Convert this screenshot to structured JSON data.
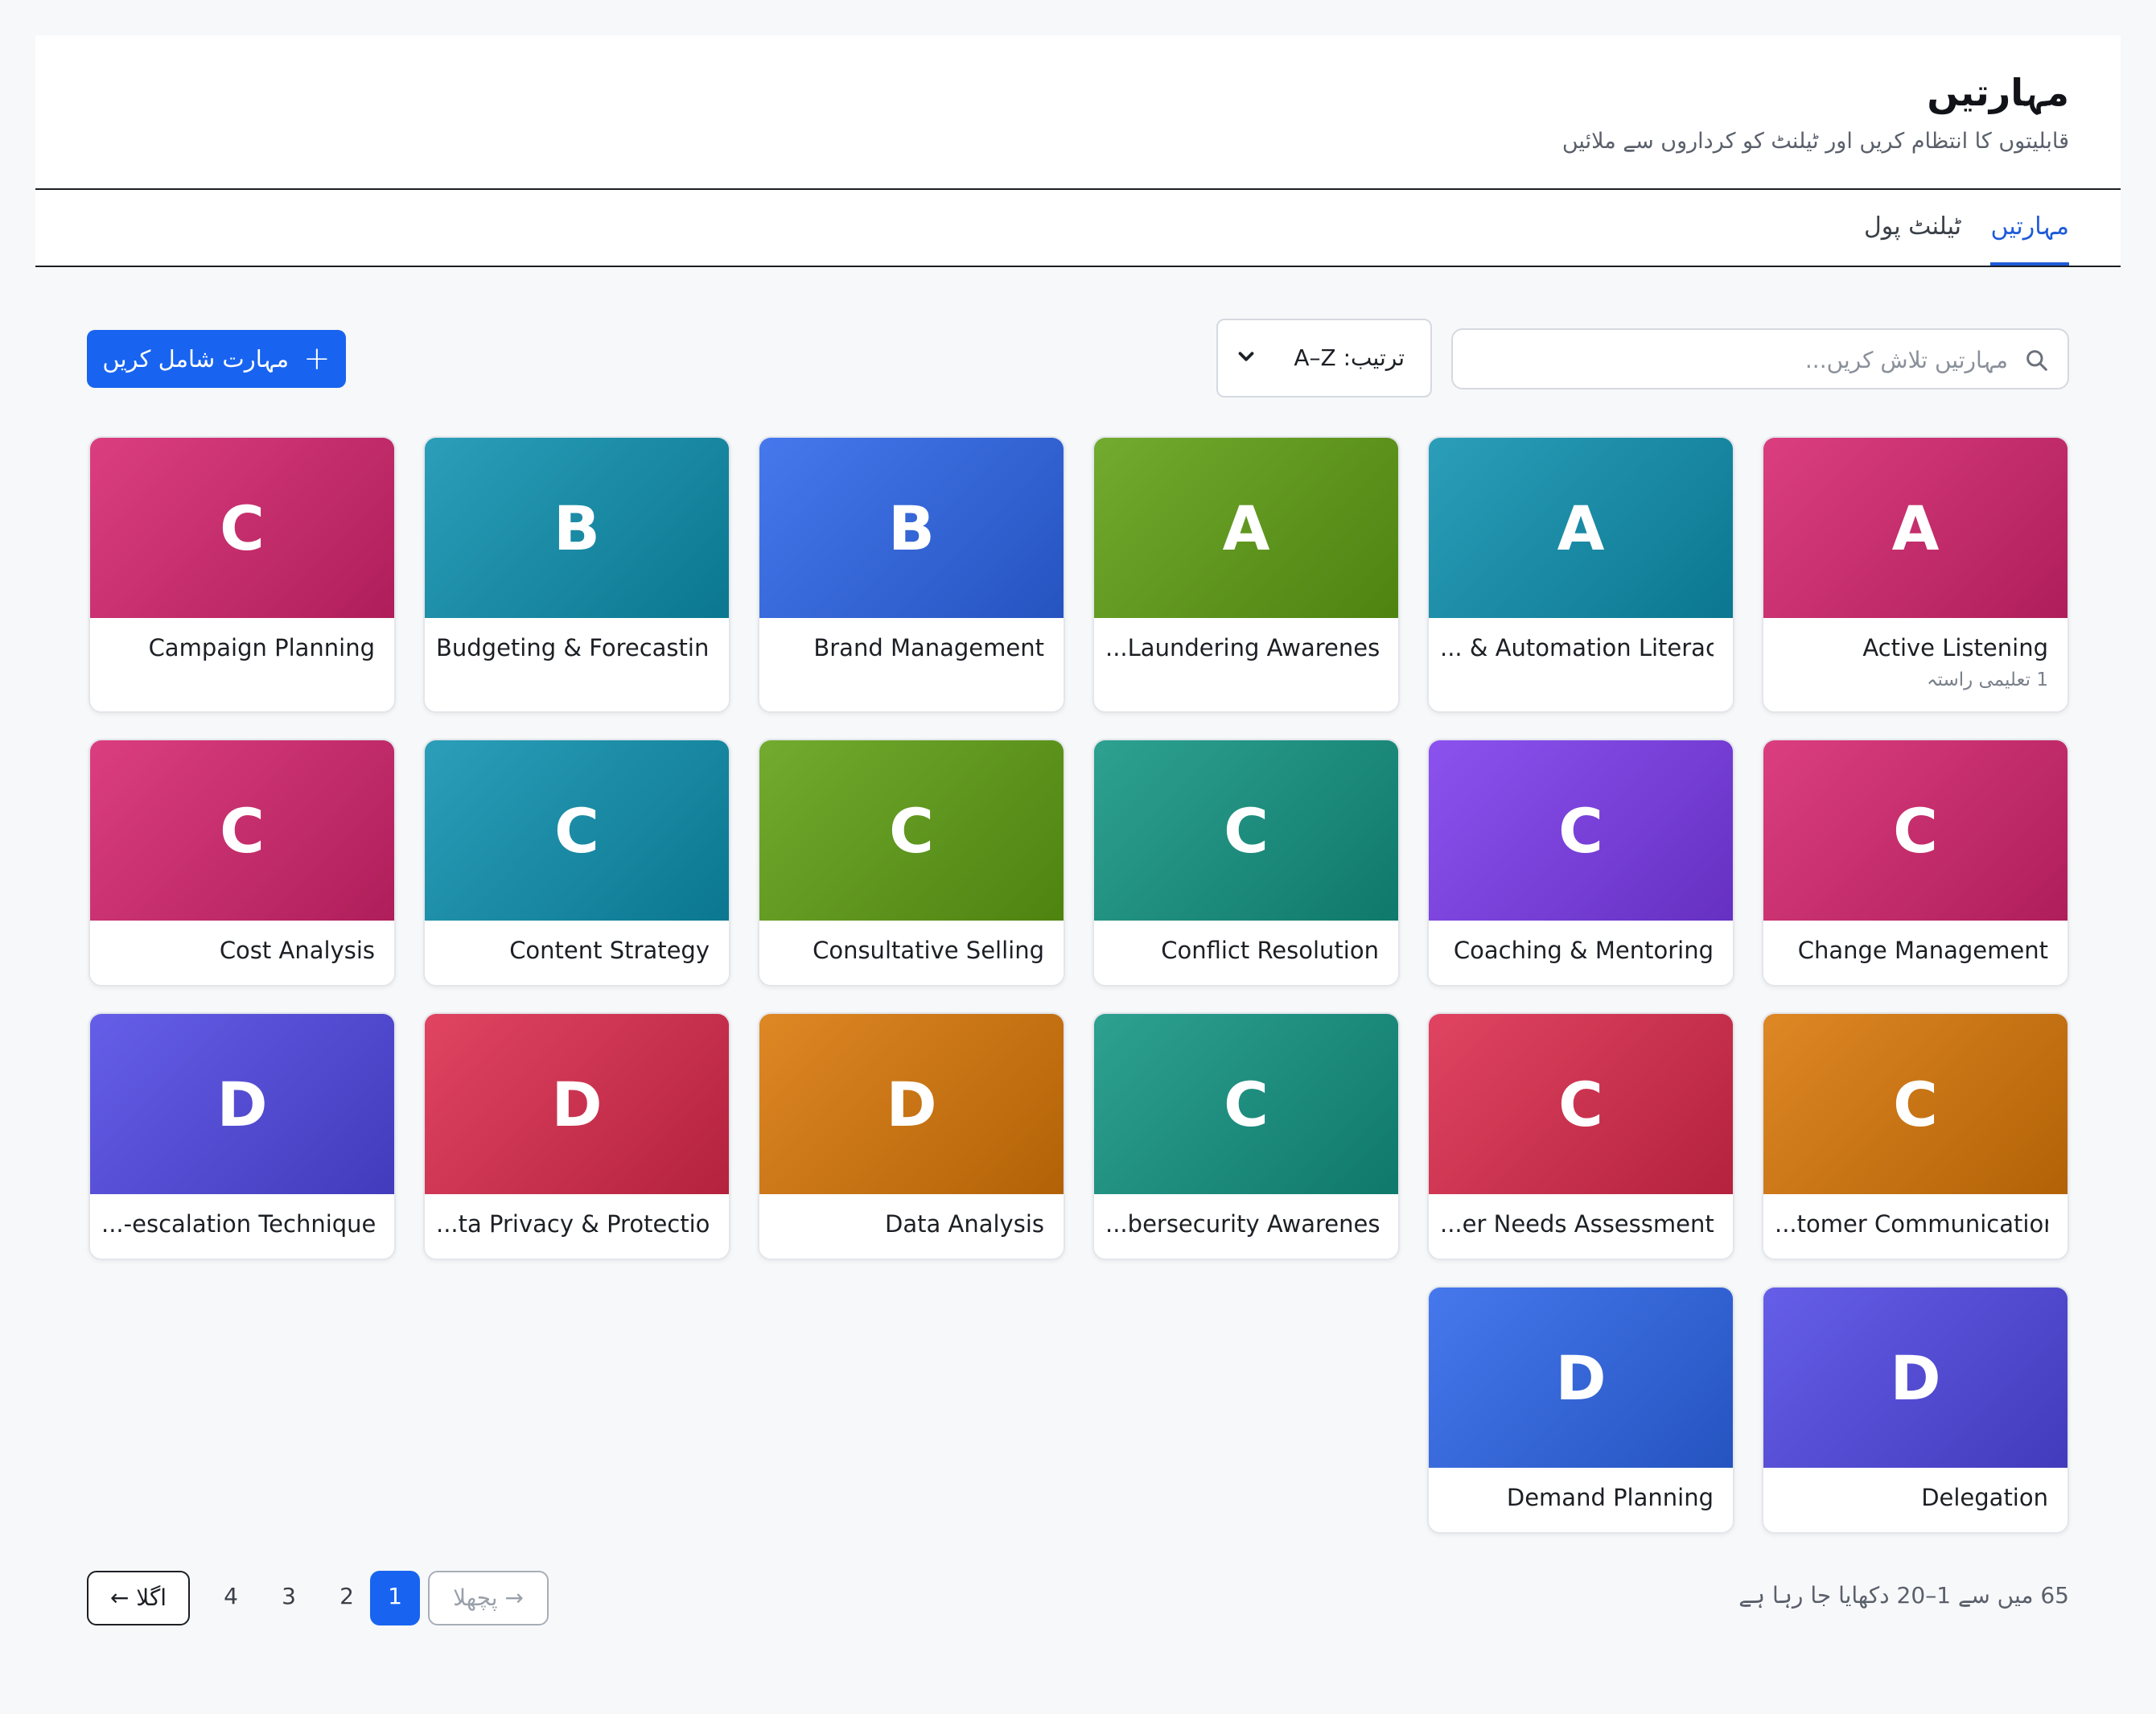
{
  "header": {
    "title": "مہارتیں",
    "subtitle": "قابلیتوں کا انتظام کریں اور ٹیلنٹ کو کرداروں سے ملائیں"
  },
  "tabs": [
    {
      "label": "مہارتیں",
      "active": true
    },
    {
      "label": "ٹیلنٹ پول",
      "active": false
    }
  ],
  "toolbar": {
    "add_label": "مہارت شامل کریں",
    "add_icon": "plus-icon",
    "sort_label": "ترتیب: A–Z",
    "search_placeholder": "مہارتیں تلاش کریں...",
    "search_value": ""
  },
  "cards": [
    {
      "letter": "A",
      "name": "Active Listening",
      "meta": "1 تعلیمی راستہ",
      "color": "#d6246e"
    },
    {
      "letter": "A",
      "name": "... & Automation Literacy",
      "meta": "",
      "color": "#0e91b0"
    },
    {
      "letter": "A",
      "name": "...Laundering Awareness",
      "meta": "",
      "color": "#5fa013"
    },
    {
      "letter": "B",
      "name": "Brand Management",
      "meta": "",
      "color": "#2d66ea"
    },
    {
      "letter": "B",
      "name": "Budgeting & Forecasting",
      "meta": "",
      "color": "#0e91b0"
    },
    {
      "letter": "C",
      "name": "Campaign Planning",
      "meta": "",
      "color": "#d6246e"
    },
    {
      "letter": "C",
      "name": "Change Management",
      "meta": "",
      "color": "#d6246e"
    },
    {
      "letter": "C",
      "name": "Coaching & Mentoring",
      "meta": "",
      "color": "#7c3aed"
    },
    {
      "letter": "C",
      "name": "Conflict Resolution",
      "meta": "",
      "color": "#129482"
    },
    {
      "letter": "C",
      "name": "Consultative Selling",
      "meta": "",
      "color": "#5fa013"
    },
    {
      "letter": "C",
      "name": "Content Strategy",
      "meta": "",
      "color": "#0e91b0"
    },
    {
      "letter": "C",
      "name": "Cost Analysis",
      "meta": "",
      "color": "#d6246e"
    },
    {
      "letter": "C",
      "name": "...tomer Communication",
      "meta": "",
      "color": "#d97707"
    },
    {
      "letter": "C",
      "name": "...er Needs Assessment",
      "meta": "",
      "color": "#dc2a4c"
    },
    {
      "letter": "C",
      "name": "...bersecurity Awareness",
      "meta": "",
      "color": "#129482"
    },
    {
      "letter": "D",
      "name": "Data Analysis",
      "meta": "",
      "color": "#d97707"
    },
    {
      "letter": "D",
      "name": "...ta Privacy & Protection",
      "meta": "",
      "color": "#dc2a4c"
    },
    {
      "letter": "D",
      "name": "...-escalation Techniques",
      "meta": "",
      "color": "#5048e5"
    },
    {
      "letter": "D",
      "name": "Delegation",
      "meta": "",
      "color": "#5048e5"
    },
    {
      "letter": "D",
      "name": "Demand Planning",
      "meta": "",
      "color": "#2d66ea"
    }
  ],
  "pagination": {
    "info": "65 میں سے 1–20 دکھایا جا رہا ہے",
    "prev_label": "→ پچھلا",
    "next_label": "اگلا ←",
    "pages": [
      "1",
      "2",
      "3",
      "4"
    ],
    "current": "1"
  }
}
